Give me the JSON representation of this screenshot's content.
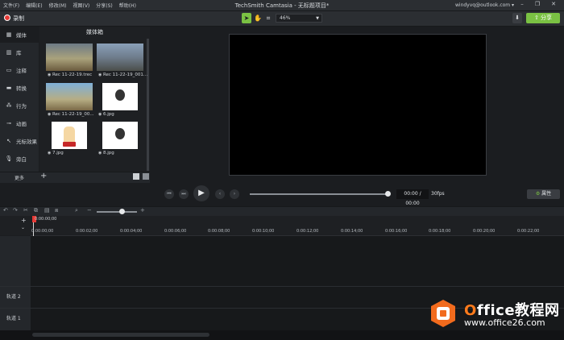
{
  "menu": [
    "文件(F)",
    "编辑(E)",
    "修改(M)",
    "视图(V)",
    "分享(S)",
    "帮助(H)"
  ],
  "app_title": "TechSmith Camtasia - 无标题项目*",
  "account": "windyvq@outlook.com ▾",
  "toolbar": {
    "record_label": "录制",
    "zoom": "46%",
    "share_label": "分享",
    "accent": "#7ac143"
  },
  "sidebar": {
    "items": [
      {
        "icon": "film-icon",
        "label": "媒体"
      },
      {
        "icon": "library-icon",
        "label": "库"
      },
      {
        "icon": "annotation-icon",
        "label": "注释"
      },
      {
        "icon": "transition-icon",
        "label": "转换"
      },
      {
        "icon": "behavior-icon",
        "label": "行为"
      },
      {
        "icon": "animation-icon",
        "label": "动画"
      },
      {
        "icon": "cursor-effect-icon",
        "label": "光标效果"
      },
      {
        "icon": "microphone-icon",
        "label": "旁白"
      }
    ],
    "more_label": "更多"
  },
  "bin": {
    "title": "媒体箱",
    "items": [
      {
        "name": "Rec 11-22-19.trec"
      },
      {
        "name": "Rec 11-22-19_001..."
      },
      {
        "name": "Rec 11-22-19_00..."
      },
      {
        "name": "6.jpg"
      },
      {
        "name": "7.jpg"
      },
      {
        "name": "8.jpg"
      }
    ]
  },
  "playback": {
    "time": "00:00 / 00:00",
    "fps": "30fps",
    "properties_label": "属性"
  },
  "timeline": {
    "playhead_time": "0:00:00;00",
    "ticks": [
      "0:00:00;00",
      "0:00:02;00",
      "0:00:04;00",
      "0:00:06;00",
      "0:00:08;00",
      "0:00:10;00",
      "0:00:12;00",
      "0:00:14;00",
      "0:00:16;00",
      "0:00:18;00",
      "0:00:20;00",
      "0:00:22;00"
    ],
    "tracks": [
      "轨道 2",
      "轨道 1"
    ]
  },
  "watermark": {
    "title_prefix": "O",
    "title_rest": "ffice教程网",
    "url": "www.office26.com"
  }
}
